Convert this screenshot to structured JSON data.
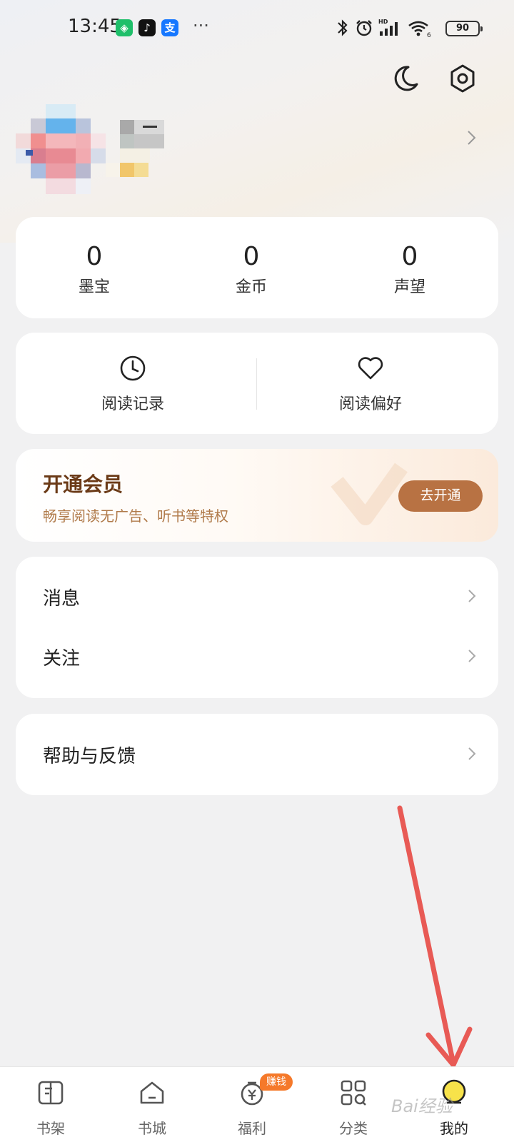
{
  "status_bar": {
    "time": "13:45",
    "battery": "90",
    "more": "···"
  },
  "stats": [
    {
      "value": "0",
      "label": "墨宝"
    },
    {
      "value": "0",
      "label": "金币"
    },
    {
      "value": "0",
      "label": "声望"
    }
  ],
  "quick_actions": [
    {
      "label": "阅读记录",
      "icon": "clock-icon"
    },
    {
      "label": "阅读偏好",
      "icon": "heart-icon"
    }
  ],
  "vip": {
    "title": "开通会员",
    "subtitle": "畅享阅读无广告、听书等特权",
    "button": "去开通"
  },
  "menu": {
    "messages": "消息",
    "follow": "关注",
    "help": "帮助与反馈"
  },
  "bottom_nav": [
    {
      "label": "书架",
      "icon": "bookshelf-icon"
    },
    {
      "label": "书城",
      "icon": "bookstore-icon"
    },
    {
      "label": "福利",
      "icon": "welfare-icon",
      "badge": "赚钱"
    },
    {
      "label": "分类",
      "icon": "category-icon"
    },
    {
      "label": "我的",
      "icon": "profile-icon",
      "active": true
    }
  ],
  "watermark": "Bai经验",
  "colors": {
    "accent": "#b87243",
    "vip_title": "#6b3a17",
    "badge": "#f5792a",
    "arrow": "#e85a55"
  }
}
